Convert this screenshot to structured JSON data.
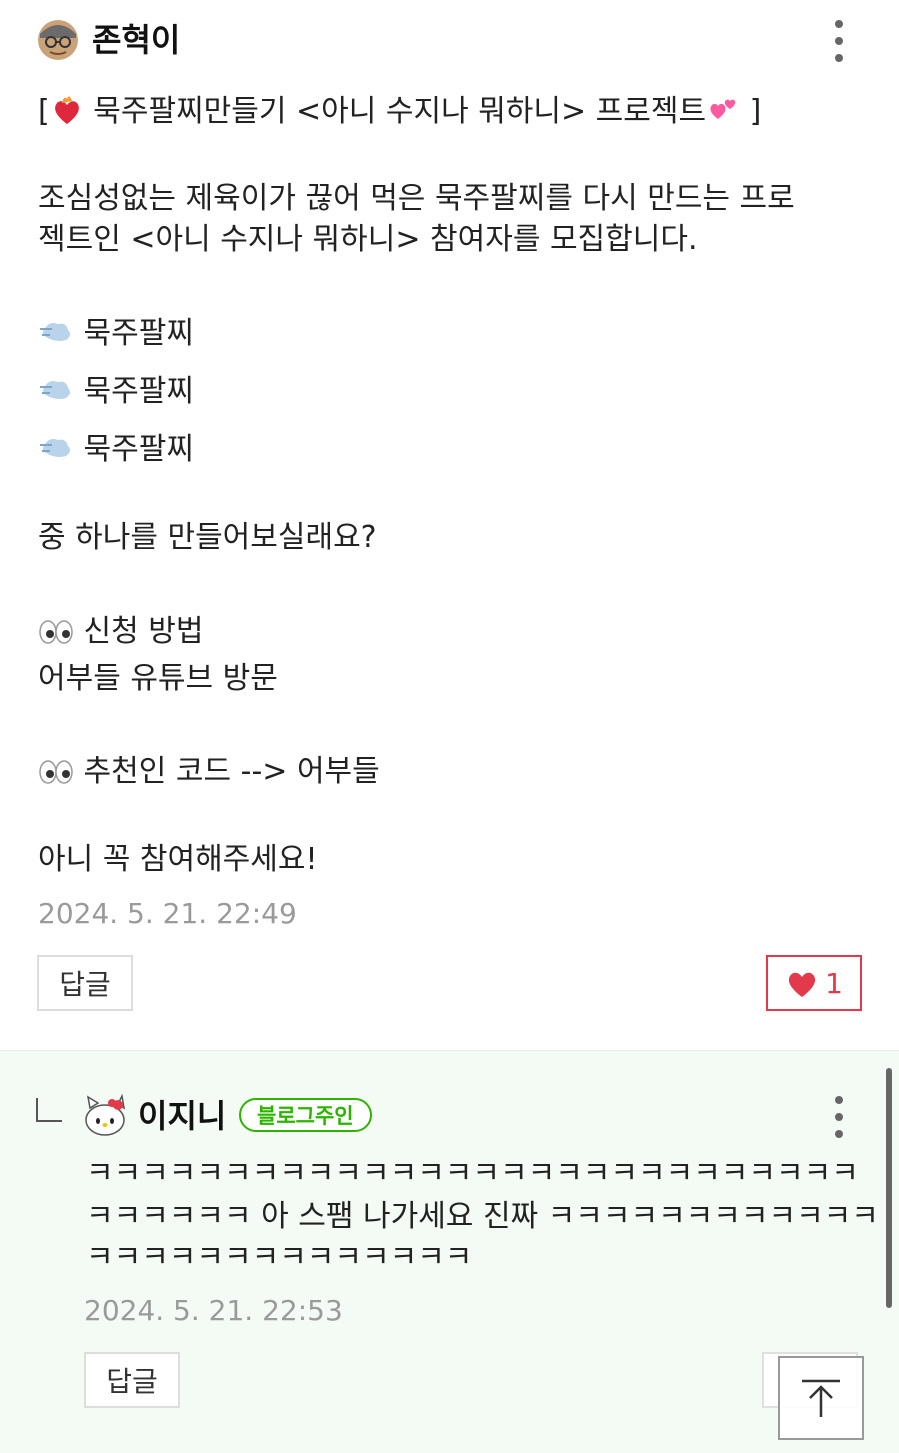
{
  "comment": {
    "author": "존혁이",
    "lines": [
      "[",
      "묵주팔찌만들기 <아니 수지나 뭐하니> 프로젝트",
      "]",
      "조심성없는 제육이가 끊어 먹은 묵주팔찌를 다시 만드는 프로",
      "젝트인 <아니 수지나 뭐하니> 참여자를 모집합니다.",
      "묵주팔찌",
      "묵주팔찌",
      "묵주팔찌",
      "중 하나를 만들어보실래요?",
      "신청 방법",
      "어부들 유튜브 방문",
      "추천인 코드 --> 어부들",
      "아니 꼭 참여해주세요!"
    ],
    "date": "2024. 5. 21. 22:49",
    "reply_label": "답글",
    "like_count": "1"
  },
  "reply": {
    "author": "이지니",
    "badge": "블로그주인",
    "lines": [
      "ㅋㅋㅋㅋㅋㅋㅋㅋㅋㅋㅋㅋㅋㅋㅋㅋㅋㅋㅋㅋㅋㅋㅋㅋㅋㅋㅋㅋ",
      "ㅋㅋㅋㅋㅋㅋ 아 스팸 나가세요 진짜 ㅋㅋㅋㅋㅋㅋㅋㅋㅋㅋㅋㅋ",
      "ㅋㅋㅋㅋㅋㅋㅋㅋㅋㅋㅋㅋㅋㅋ"
    ],
    "date": "2024. 5. 21. 22:53",
    "reply_label": "답글"
  },
  "colors": {
    "accent_green": "#2db400",
    "like_red": "#e2394b",
    "reply_bg": "#f4fbf4"
  },
  "icons": [
    "avatar-icon",
    "more-options-icon",
    "heart-fire-emoji",
    "hearts-emoji",
    "dash-emoji",
    "eyes-emoji",
    "heart-icon",
    "reply-arrow-icon",
    "hello-kitty-avatar",
    "scroll-top-icon"
  ]
}
